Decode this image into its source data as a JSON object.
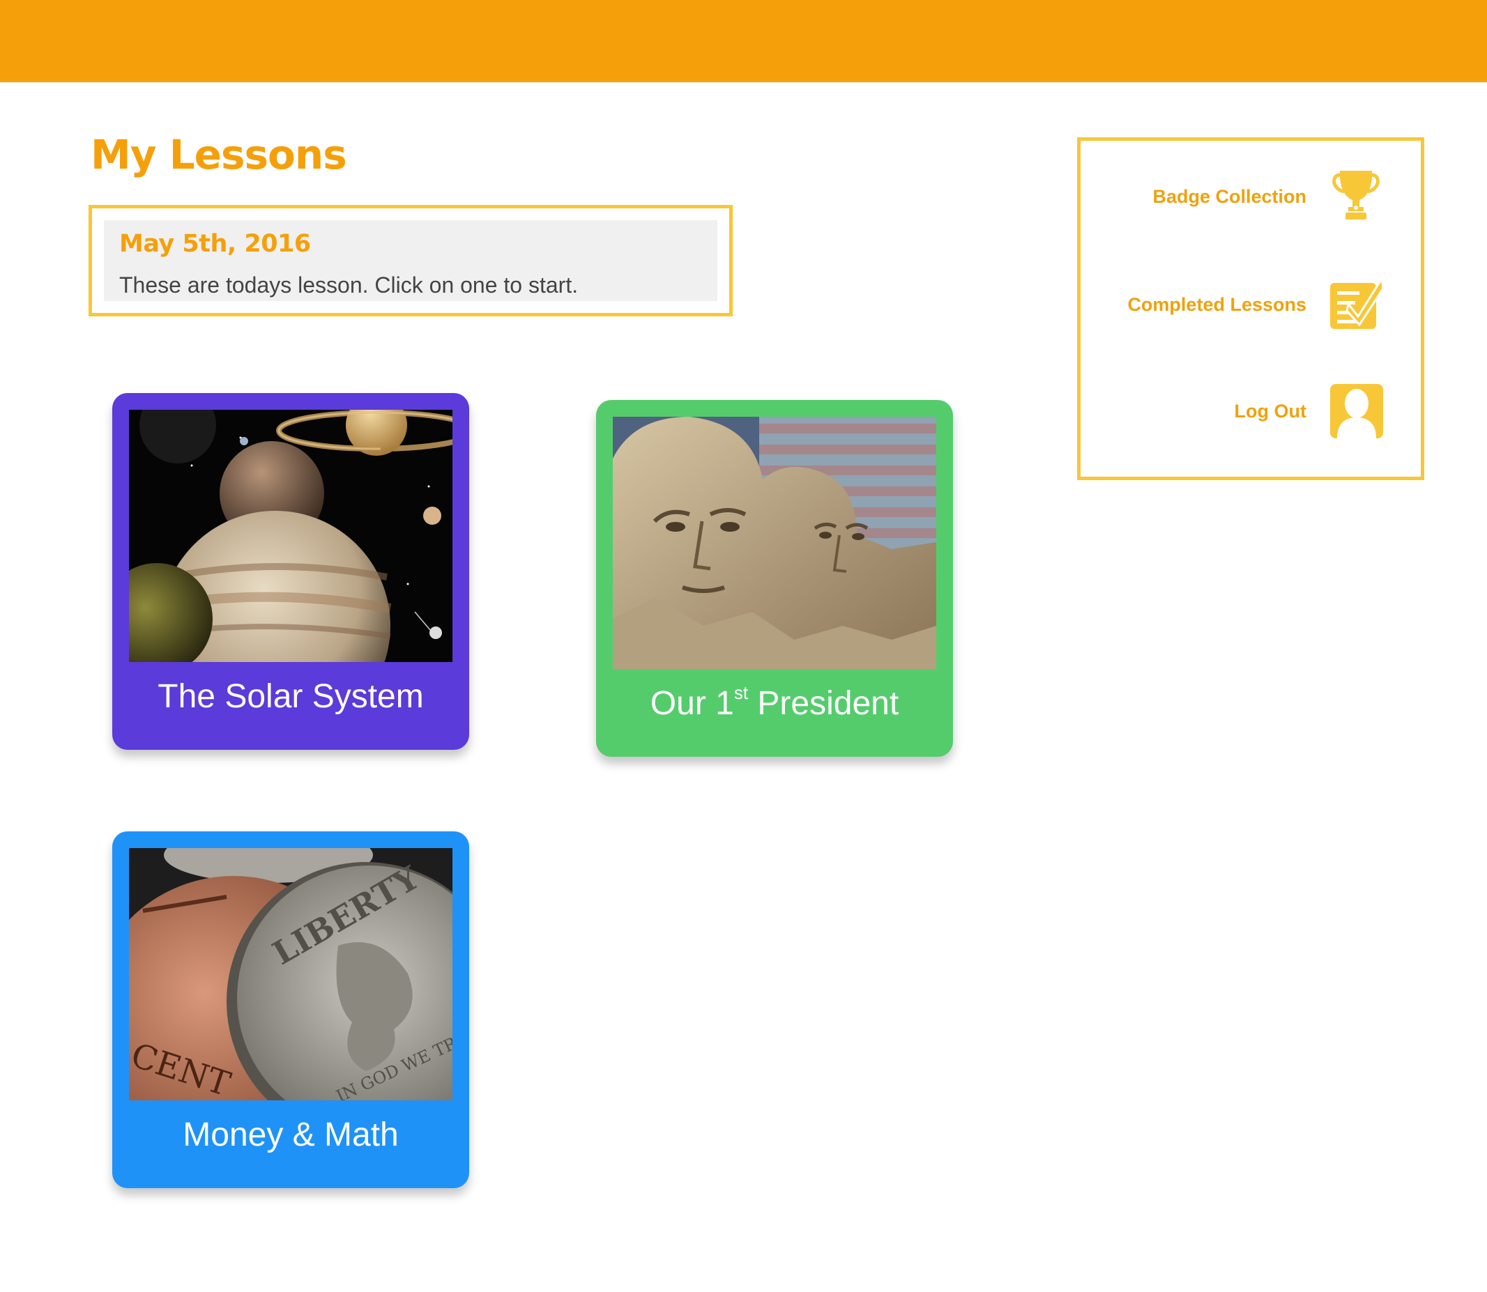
{
  "header": {
    "bar_color": "#f5a00a"
  },
  "page": {
    "title": "My Lessons"
  },
  "today": {
    "date": "May 5th, 2016",
    "description": "These are todays lesson. Click on one to start."
  },
  "sidebar": {
    "items": [
      {
        "label": "Badge Collection",
        "icon": "trophy-icon"
      },
      {
        "label": "Completed Lessons",
        "icon": "checklist-icon"
      },
      {
        "label": "Log Out",
        "icon": "user-icon"
      }
    ]
  },
  "lessons": [
    {
      "title": "The Solar System",
      "color": "#5b3bd9",
      "image": "planets-image"
    },
    {
      "title_prefix": "Our 1",
      "title_sup": "st",
      "title_suffix": " President",
      "color": "#55cc6c",
      "image": "mount-rushmore-image"
    },
    {
      "title": "Money & Math",
      "color": "#1f92f8",
      "image": "coins-image"
    }
  ],
  "colors": {
    "accent": "#f5a00a",
    "border": "#f8c737",
    "icon": "#f8c737"
  }
}
